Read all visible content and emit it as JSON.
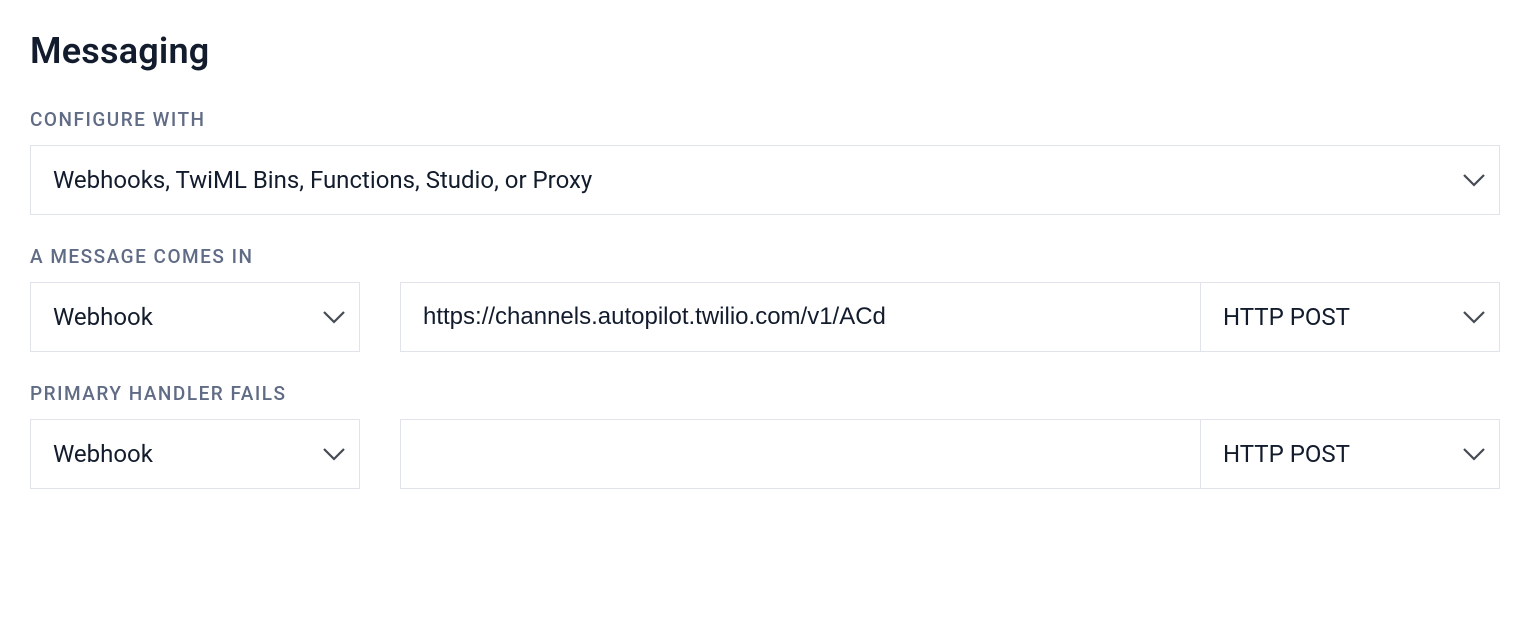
{
  "section": {
    "title": "Messaging"
  },
  "configureWith": {
    "label": "CONFIGURE WITH",
    "value": "Webhooks, TwiML Bins, Functions, Studio, or Proxy"
  },
  "messageComesIn": {
    "label": "A MESSAGE COMES IN",
    "handlerType": "Webhook",
    "url": "https://channels.autopilot.twilio.com/v1/ACd",
    "method": "HTTP POST"
  },
  "primaryHandlerFails": {
    "label": "PRIMARY HANDLER FAILS",
    "handlerType": "Webhook",
    "url": "",
    "method": "HTTP POST"
  }
}
